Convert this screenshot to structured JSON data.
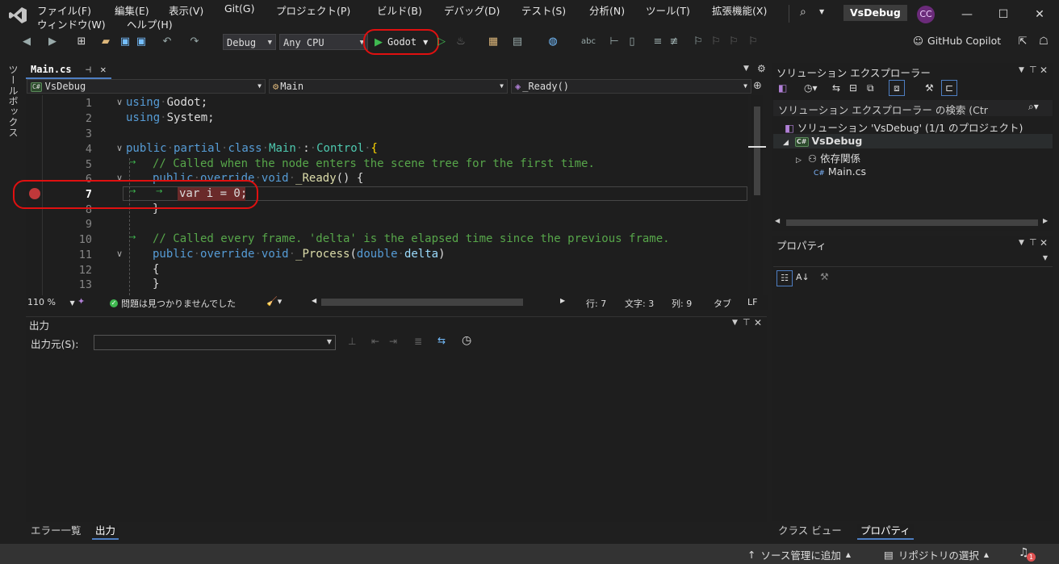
{
  "menu": {
    "row1": [
      "ファイル(F)",
      "編集(E)",
      "表示(V)",
      "Git(G)",
      "プロジェクト(P)",
      "ビルド(B)",
      "デバッグ(D)",
      "テスト(S)",
      "分析(N)",
      "ツール(T)",
      "拡張機能(X)"
    ],
    "row2": [
      "ウィンドウ(W)",
      "ヘルプ(H)"
    ]
  },
  "title": {
    "project_name": "VsDebug",
    "avatar_initials": "CC"
  },
  "toolbar": {
    "config": "Debug",
    "platform": "Any CPU",
    "run_target": "Godot",
    "copilot": "GitHub Copilot"
  },
  "toolbox_label": "ツールボックス",
  "editor": {
    "tab": "Main.cs",
    "nav": {
      "project": "VsDebug",
      "class": "Main",
      "member": "_Ready()"
    },
    "line_numbers": [
      "1",
      "2",
      "3",
      "4",
      "5",
      "6",
      "7",
      "8",
      "9",
      "10",
      "11",
      "12",
      "13"
    ],
    "lines": {
      "l1_kw": "using",
      "l1_rest": "Godot;",
      "l2_kw": "using",
      "l2_rest": "System;",
      "l4_kw1": "public",
      "l4_kw2": "partial",
      "l4_kw3": "class",
      "l4_cls": "Main",
      "l4_colon": ":",
      "l4_base": "Control",
      "l4_brace": "{",
      "l5_comment": "// Called when the node enters the scene tree for the first time.",
      "l6_kw1": "public",
      "l6_kw2": "override",
      "l6_kw3": "void",
      "l6_name": "_Ready",
      "l6_rest": "() {",
      "l7_code": "var i = 0;",
      "l8_brace": "}",
      "l10_comment": "// Called every frame. 'delta' is the elapsed time since the previous frame.",
      "l11_kw1": "public",
      "l11_kw2": "override",
      "l11_kw3": "void",
      "l11_name": "_Process",
      "l11_open": "(",
      "l11_type": "double",
      "l11_param": "delta",
      "l11_close": ")",
      "l12_brace": "{",
      "l13_brace": "}"
    },
    "status": {
      "zoom": "110 %",
      "issues": "問題は見つかりませんでした",
      "line": "行: 7",
      "char": "文字: 3",
      "col": "列: 9",
      "tab": "タブ",
      "eol": "LF"
    }
  },
  "output": {
    "title": "出力",
    "source_label": "出力元(S):",
    "tabs": [
      "エラー一覧",
      "出力"
    ]
  },
  "solution_explorer": {
    "title": "ソリューション エクスプローラー",
    "search_placeholder": "ソリューション エクスプローラー の検索 (Ctr",
    "solution": "ソリューション 'VsDebug' (1/1 のプロジェクト)",
    "project": "VsDebug",
    "dependencies": "依存関係",
    "file": "Main.cs"
  },
  "properties": {
    "title": "プロパティ",
    "tabs": [
      "クラス ビュー",
      "プロパティ"
    ]
  },
  "statusbar": {
    "source_control": "ソース管理に追加",
    "repo": "リポジトリの選択",
    "notifications": "1"
  },
  "colors": {
    "accent": "#4e7ec2",
    "breakpoint": "#c0383a",
    "highlight_oval": "#e01010"
  }
}
